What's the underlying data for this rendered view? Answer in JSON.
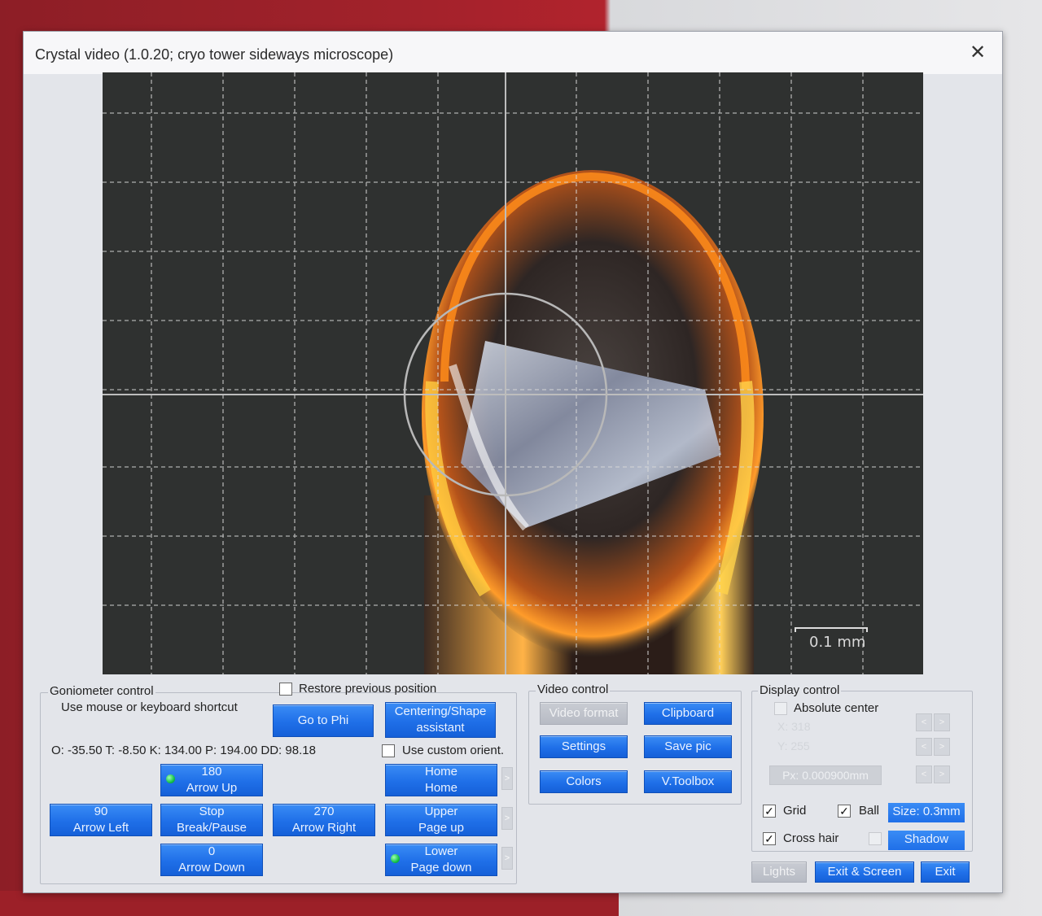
{
  "window": {
    "title": "Crystal video (1.0.20; cryo tower sideways microscope)",
    "close_glyph": "✕"
  },
  "video": {
    "scale_label": "0.1 mm",
    "grid": true,
    "cross_hair": true,
    "ball": true
  },
  "goniometer": {
    "group_label": "Goniometer control",
    "hint": "Use mouse or keyboard shortcut",
    "restore_label": "Restore previous position",
    "restore_checked": false,
    "goto_phi": "Go to Phi",
    "centering_line1": "Centering/Shape",
    "centering_line2": "assistant",
    "status": "O: -35.50 T:  -8.50 K: 134.00 P: 194.00 DD:  98.18",
    "custom_orient_label": "Use custom orient.",
    "custom_orient_checked": false,
    "btn_180_line1": "180",
    "btn_180_line2": "Arrow Up",
    "btn_90_line1": "90",
    "btn_90_line2": "Arrow Left",
    "btn_stop_line1": "Stop",
    "btn_stop_line2": "Break/Pause",
    "btn_270_line1": "270",
    "btn_270_line2": "Arrow Right",
    "btn_0_line1": "0",
    "btn_0_line2": "Arrow Down",
    "btn_home_line1": "Home",
    "btn_home_line2": "Home",
    "btn_upper_line1": "Upper",
    "btn_upper_line2": "Page up",
    "btn_lower_line1": "Lower",
    "btn_lower_line2": "Page down",
    "side_arrow": ">"
  },
  "video_control": {
    "group_label": "Video control",
    "video_format": "Video format",
    "clipboard": "Clipboard",
    "settings": "Settings",
    "save_pic": "Save pic",
    "colors": "Colors",
    "v_toolbox": "V.Toolbox"
  },
  "display_control": {
    "group_label": "Display control",
    "absolute_center": "Absolute center",
    "x_ghost": "X: 318",
    "y_ghost": "Y: 255",
    "px_field": "Px: 0.000900mm",
    "nudge_left": "<",
    "nudge_right": ">",
    "grid_label": "Grid",
    "ball_label": "Ball",
    "size_label": "Size: 0.3mm",
    "cross_hair_label": "Cross hair",
    "shadow_label": "Shadow",
    "check_glyph": "✓"
  },
  "footer": {
    "lights": "Lights",
    "exit_screen": "Exit & Screen",
    "exit": "Exit"
  }
}
